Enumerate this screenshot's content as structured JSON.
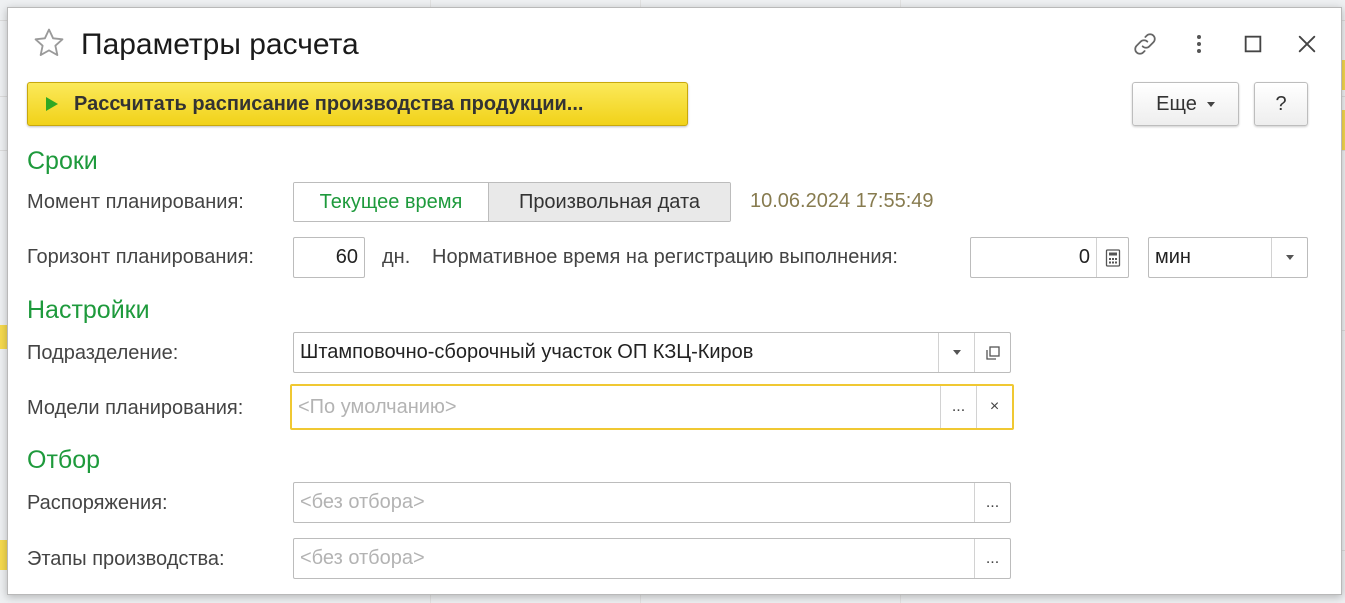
{
  "window": {
    "title": "Параметры расчета",
    "icons": [
      "star-icon",
      "link-icon",
      "more-vertical-icon",
      "maximize-icon",
      "close-icon"
    ]
  },
  "toolbar": {
    "run_label": "Рассчитать расписание производства продукции...",
    "more_label": "Еще",
    "help_label": "?"
  },
  "sections": {
    "terms": "Сроки",
    "settings": "Настройки",
    "filter": "Отбор"
  },
  "terms": {
    "moment_label": "Момент планирования:",
    "option_current": "Текущее время",
    "option_custom": "Произвольная дата",
    "selected_option": "Текущее время",
    "datetime": "10.06.2024 17:55:49",
    "horizon_label": "Горизонт планирования:",
    "horizon_value": "60",
    "horizon_unit": "дн.",
    "norm_label": "Нормативное время на регистрацию выполнения:",
    "norm_value": "0",
    "norm_unit": "мин"
  },
  "settings": {
    "department_label": "Подразделение:",
    "department_value": "Штамповочно-сборочный участок ОП КЗЦ-Киров",
    "models_label": "Модели планирования:",
    "models_placeholder": "<По умолчанию>",
    "models_select": "...",
    "models_clear": "×"
  },
  "filter": {
    "orders_label": "Распоряжения:",
    "orders_placeholder": "<без отбора>",
    "stages_label": "Этапы производства:",
    "stages_placeholder": "<без отбора>",
    "select_label": "..."
  },
  "colors": {
    "accent_green": "#1e9a3c",
    "run_button_yellow": "#f1d219",
    "focus_border": "#f0c832",
    "date_text": "#877b4f"
  }
}
